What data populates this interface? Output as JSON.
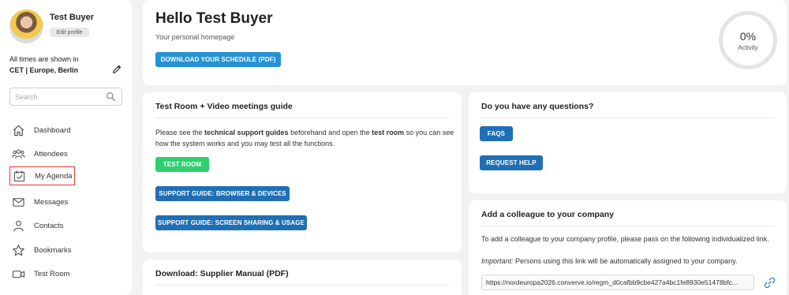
{
  "sidebar": {
    "user_name": "Test Buyer",
    "edit_profile": "Edit profile",
    "timezone_label": "All times are shown in",
    "timezone_value": "CET | Europe, Berlin",
    "search_placeholder": "Search",
    "items": [
      {
        "label": "Dashboard",
        "icon": "home-icon"
      },
      {
        "label": "Attendees",
        "icon": "people-icon"
      },
      {
        "label": "My Agenda",
        "icon": "calendar-check-icon"
      },
      {
        "label": "Messages",
        "icon": "envelope-icon"
      },
      {
        "label": "Contacts",
        "icon": "person-icon"
      },
      {
        "label": "Bookmarks",
        "icon": "star-icon"
      },
      {
        "label": "Test Room",
        "icon": "video-camera-icon"
      }
    ]
  },
  "welcome": {
    "title": "Hello Test Buyer",
    "subtitle": "Your personal homepage",
    "download_button": "DOWNLOAD YOUR SCHEDULE (PDF)",
    "activity_value": "0%",
    "activity_label": "Activity"
  },
  "guide": {
    "title": "Test Room + Video meetings guide",
    "text_1": "Please see the ",
    "text_bold_1": "technical support guides",
    "text_2": " beforehand and open the ",
    "text_bold_2": "test room",
    "text_3": " so you can see",
    "text_line2": "how the system works and you may test all the functions.",
    "test_room_button": "TEST ROOM",
    "browser_guide_button": "SUPPORT GUIDE: BROWSER & DEVICES",
    "screen_guide_button": "SUPPORT GUIDE: SCREEN SHARING & USAGE"
  },
  "questions": {
    "title": "Do you have any questions?",
    "faqs_button": "FAQS",
    "request_help_button": "REQUEST HELP"
  },
  "colleague": {
    "title": "Add a colleague to your company",
    "text": "To add a colleague to your company profile, please pass on the following individualized link.",
    "important_label": "Important:",
    "important_text": " Persons using this link will be automatically assigned to your company.",
    "link": "https://nordeuropa2026.converve.io/regm_d0cafbb9cbe427a4bc1fe8930e51478bfc..."
  },
  "supplier": {
    "title": "Download: Supplier Manual (PDF)"
  },
  "colors": {
    "button_blue": "#1f6fb6",
    "button_lightblue": "#2592d6",
    "button_green": "#2ed06e",
    "highlight_red": "#e53935"
  }
}
